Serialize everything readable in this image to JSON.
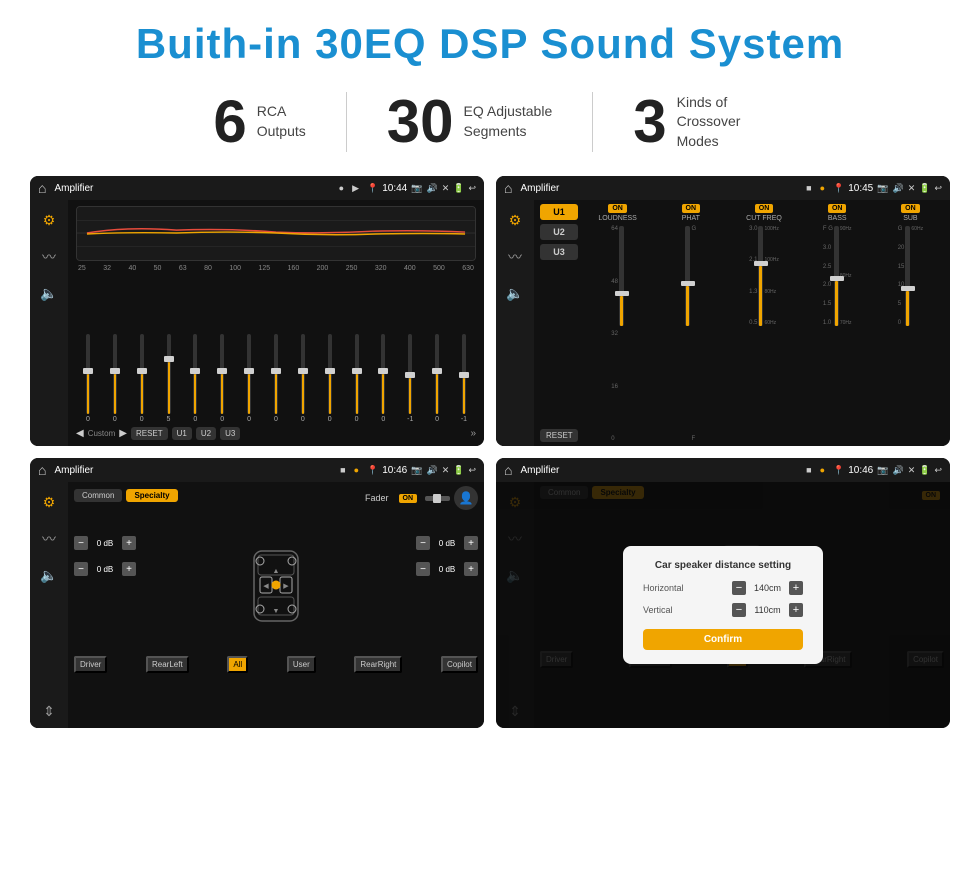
{
  "title": "Buith-in 30EQ DSP Sound System",
  "stats": [
    {
      "number": "6",
      "label_line1": "RCA",
      "label_line2": "Outputs"
    },
    {
      "number": "30",
      "label_line1": "EQ Adjustable",
      "label_line2": "Segments"
    },
    {
      "number": "3",
      "label_line1": "Kinds of",
      "label_line2": "Crossover Modes"
    }
  ],
  "screens": [
    {
      "id": "eq-screen",
      "status_bar": {
        "title": "Amplifier",
        "time": "10:44"
      }
    },
    {
      "id": "crossover-screen",
      "status_bar": {
        "title": "Amplifier",
        "time": "10:45"
      }
    },
    {
      "id": "fader-screen",
      "status_bar": {
        "title": "Amplifier",
        "time": "10:46"
      }
    },
    {
      "id": "dialog-screen",
      "status_bar": {
        "title": "Amplifier",
        "time": "10:46"
      },
      "dialog": {
        "title": "Car speaker distance setting",
        "horizontal_label": "Horizontal",
        "horizontal_value": "140cm",
        "vertical_label": "Vertical",
        "vertical_value": "110cm",
        "confirm_btn": "Confirm"
      }
    }
  ],
  "eq": {
    "freq_labels": [
      "25",
      "32",
      "40",
      "50",
      "63",
      "80",
      "100",
      "125",
      "160",
      "200",
      "250",
      "320",
      "400",
      "500",
      "630"
    ],
    "sliders": [
      {
        "value": "0",
        "pos": 50
      },
      {
        "value": "0",
        "pos": 50
      },
      {
        "value": "0",
        "pos": 50
      },
      {
        "value": "5",
        "pos": 35
      },
      {
        "value": "0",
        "pos": 50
      },
      {
        "value": "0",
        "pos": 50
      },
      {
        "value": "0",
        "pos": 50
      },
      {
        "value": "0",
        "pos": 50
      },
      {
        "value": "0",
        "pos": 50
      },
      {
        "value": "0",
        "pos": 50
      },
      {
        "value": "0",
        "pos": 50
      },
      {
        "value": "0",
        "pos": 50
      },
      {
        "value": "-1",
        "pos": 55
      },
      {
        "value": "0",
        "pos": 50
      },
      {
        "value": "-1",
        "pos": 55
      }
    ],
    "preset": "Custom",
    "buttons": [
      "RESET",
      "U1",
      "U2",
      "U3"
    ]
  },
  "crossover": {
    "u_buttons": [
      "U1",
      "U2",
      "U3"
    ],
    "channels": [
      {
        "name": "LOUDNESS",
        "on": true
      },
      {
        "name": "PHAT",
        "on": true
      },
      {
        "name": "CUT FREQ",
        "on": true
      },
      {
        "name": "BASS",
        "on": true
      },
      {
        "name": "SUB",
        "on": true
      }
    ],
    "reset_btn": "RESET"
  },
  "fader": {
    "tabs": [
      "Common",
      "Specialty"
    ],
    "fader_label": "Fader",
    "on_text": "ON",
    "db_values": [
      "0 dB",
      "0 dB",
      "0 dB",
      "0 dB"
    ],
    "bottom_labels": [
      "Driver",
      "RearLeft",
      "All",
      "User",
      "RearRight",
      "Copilot"
    ]
  },
  "dialog": {
    "title": "Car speaker distance setting",
    "horizontal_label": "Horizontal",
    "horizontal_value": "140cm",
    "vertical_label": "Vertical",
    "vertical_value": "110cm",
    "confirm_btn": "Confirm"
  }
}
